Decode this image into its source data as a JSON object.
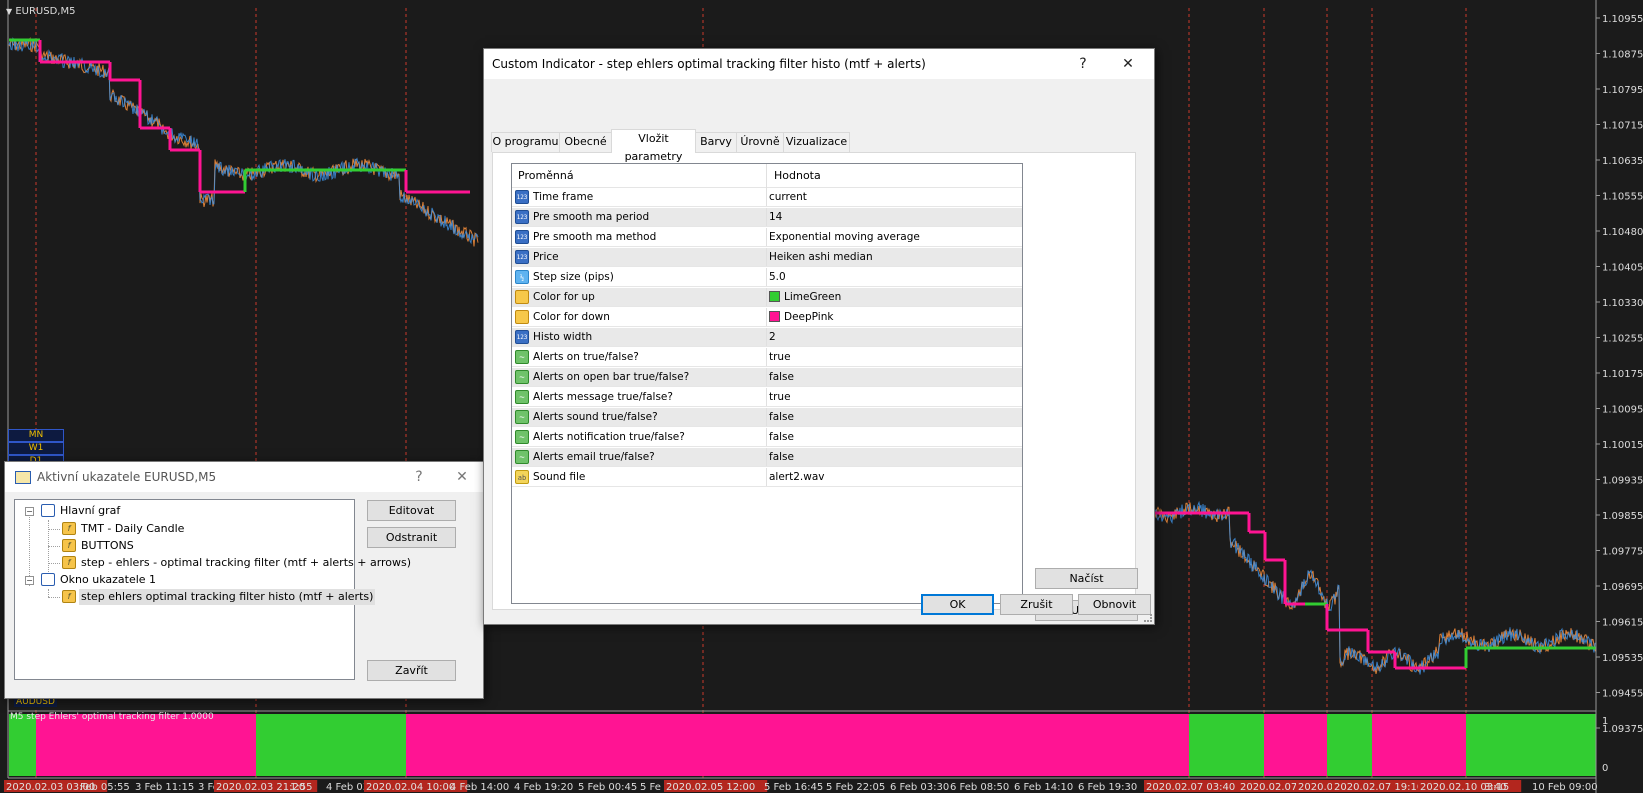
{
  "chart": {
    "symbol_label": "EURUSD,M5",
    "sub_symbol_label": "AUDUSD",
    "indicator_window_label": "M5 step Ehlers' optimal tracking filter 1.0000",
    "price_axis": [
      "1.10955",
      "1.10875",
      "1.10795",
      "1.10715",
      "1.10635",
      "1.10555",
      "1.10480",
      "1.10405",
      "1.10330",
      "1.10255",
      "1.10175",
      "1.10095",
      "1.10015",
      "1.09935",
      "1.09855",
      "1.09775",
      "1.09695",
      "1.09615",
      "1.09535",
      "1.09455",
      "1.09375"
    ],
    "sub_axis": [
      "1",
      "0"
    ],
    "time_axis": [
      "2020.02.03 03:00",
      "Feb 05:55",
      "3 Feb 11:15",
      "3 Fe",
      "2020.02.03 21:20",
      "1:55",
      "4 Feb 03:",
      "2020.02.04 10:00",
      "4 Feb 14:00",
      "4 Feb 19:20",
      "5 Feb 00:45",
      "5 Fe",
      "2020.02.05 12:00",
      "5 Feb 16:45",
      "5 Feb 22:05",
      "6 Feb 03:30",
      "6 Feb 08:50",
      "6 Feb 14:10",
      "6 Feb 19:30",
      "2020.02.07 03:40",
      "2020.02.07 10",
      "2020.02.0",
      "2020.02.07 19:10",
      "2020.02.10 03:15",
      "3:40",
      "10 Feb 09:00"
    ],
    "timeframes": [
      "MN",
      "W1",
      "D1"
    ],
    "colors": {
      "up": "#32cd32",
      "down": "#ff1493",
      "bg": "#1b1b1b",
      "separator": "#c8392b",
      "tf_text": "#f0c000"
    }
  },
  "active_indicators": {
    "title": "Aktivní ukazatele EURUSD,M5",
    "help_glyph": "?",
    "close_glyph": "✕",
    "tree": {
      "main": "Hlavní graf",
      "main_items": [
        "TMT - Daily Candle",
        "BUTTONS",
        "step - ehlers - optimal tracking filter (mtf + alerts + arrows)"
      ],
      "sub": "Okno ukazatele 1",
      "sub_items": [
        "step ehlers optimal tracking filter histo (mtf + alerts)"
      ]
    },
    "buttons": {
      "edit": "Editovat",
      "remove": "Odstranit",
      "close": "Zavřít"
    }
  },
  "custom_indicator": {
    "title": "Custom Indicator - step ehlers optimal tracking filter histo (mtf + alerts)",
    "help_glyph": "?",
    "close_glyph": "✕",
    "tabs": [
      "O programu",
      "Obecné",
      "Vložit parametry",
      "Barvy",
      "Úrovně",
      "Vizualizace"
    ],
    "active_tab": "Vložit parametry",
    "columns": {
      "variable": "Proměnná",
      "value": "Hodnota"
    },
    "params": [
      {
        "icon": "int",
        "name": "Time frame",
        "value": "current"
      },
      {
        "icon": "int",
        "name": "Pre smooth ma period",
        "value": "14"
      },
      {
        "icon": "int",
        "name": "Pre smooth ma method",
        "value": "Exponential moving average"
      },
      {
        "icon": "int",
        "name": "Price",
        "value": "Heiken ashi median"
      },
      {
        "icon": "double",
        "name": "Step size (pips)",
        "value": "5.0"
      },
      {
        "icon": "color",
        "name": "Color for up",
        "value": "LimeGreen",
        "swatch": "#32cd32"
      },
      {
        "icon": "color",
        "name": "Color for down",
        "value": "DeepPink",
        "swatch": "#ff1493"
      },
      {
        "icon": "int",
        "name": "Histo width",
        "value": "2"
      },
      {
        "icon": "bool",
        "name": "Alerts on true/false?",
        "value": "true"
      },
      {
        "icon": "bool",
        "name": "Alerts on open bar true/false?",
        "value": "false"
      },
      {
        "icon": "bool",
        "name": "Alerts message true/false?",
        "value": "true"
      },
      {
        "icon": "bool",
        "name": "Alerts sound true/false?",
        "value": "false"
      },
      {
        "icon": "bool",
        "name": "Alerts notification true/false?",
        "value": "false"
      },
      {
        "icon": "bool",
        "name": "Alerts email true/false?",
        "value": "false"
      },
      {
        "icon": "string",
        "name": "Sound file",
        "value": "alert2.wav"
      }
    ],
    "icon_glyphs": {
      "int": "123",
      "double": "½",
      "color": "",
      "bool": "~",
      "string": "ab"
    },
    "buttons": {
      "load": "Načíst",
      "save": "Uložit",
      "ok": "OK",
      "cancel": "Zrušit",
      "reset": "Obnovit"
    }
  }
}
